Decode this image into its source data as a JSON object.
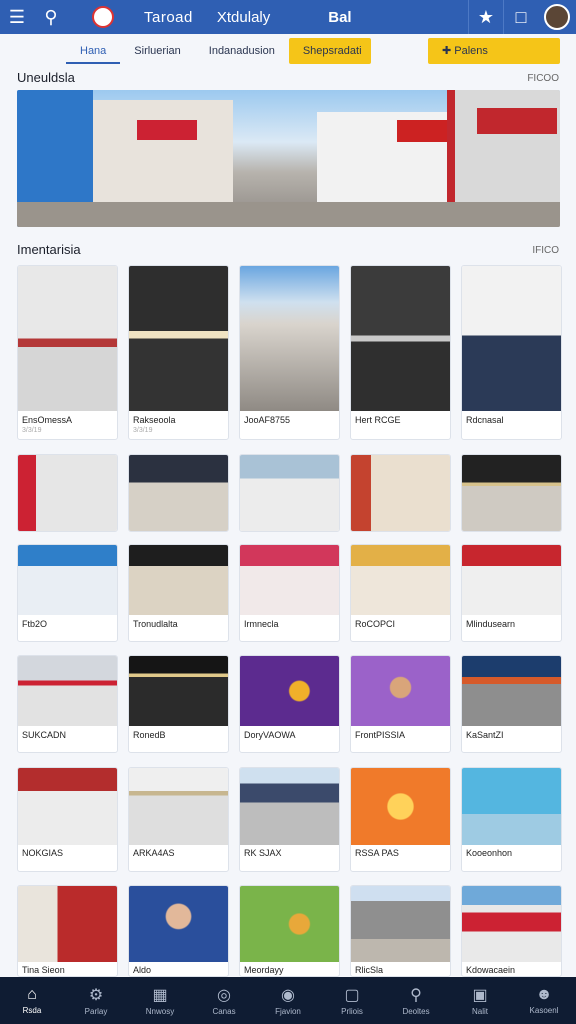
{
  "header": {
    "title": "Taroad",
    "subtitle": "Xtdulaly",
    "brand": "Bal",
    "icons": [
      "menu-icon",
      "search-icon",
      "pet-icon",
      "bell-icon",
      "chat-icon"
    ]
  },
  "tabs": [
    {
      "label": "Hana",
      "active": true
    },
    {
      "label": "Sirluerian"
    },
    {
      "label": "Indanadusion"
    },
    {
      "label": "Shepsradati",
      "style": "yellow"
    },
    {
      "label": "Palens",
      "style": "yellow2"
    }
  ],
  "sections": {
    "featured": {
      "title": "Uneuldsla",
      "more": "FICOO"
    },
    "grid": {
      "title": "Imentarisia",
      "more": "IFICO"
    }
  },
  "rows": [
    {
      "type": "tall",
      "cards": [
        {
          "label": "EnsOmessA",
          "sub": "3/3/19",
          "bg": "#c9ced6"
        },
        {
          "label": "Rakseoola",
          "sub": "3/3/19",
          "bg": "#3a3a3a"
        },
        {
          "label": "JooAF8755",
          "sub": "",
          "bg": "#87a8c8"
        },
        {
          "label": "Hert RCGE",
          "sub": "",
          "bg": "#555b63"
        },
        {
          "label": "Rdcnasal",
          "sub": "",
          "bg": "#8d95a0"
        }
      ]
    },
    {
      "type": "short",
      "cards": [
        {
          "label": "",
          "bg": "#b23b3b"
        },
        {
          "label": "",
          "bg": "#2b3140"
        },
        {
          "label": "",
          "bg": "#a9c2d6"
        },
        {
          "label": "",
          "bg": "#c4432f"
        },
        {
          "label": "",
          "bg": "#222222"
        }
      ]
    },
    {
      "type": "tall2",
      "cards": [
        {
          "label": "Ftb2O",
          "sub": "",
          "bg": "#2f7fc9"
        },
        {
          "label": "Tronudlalta",
          "sub": "",
          "bg": "#1e1e1e"
        },
        {
          "label": "Irmnecla",
          "sub": "",
          "bg": "#d2375b"
        },
        {
          "label": "RoCOPCI",
          "sub": "",
          "bg": "#e3b047"
        },
        {
          "label": "Mlindusearn",
          "sub": "",
          "bg": "#c7262e"
        }
      ]
    },
    {
      "type": "tall3",
      "cards": [
        {
          "label": "SUKCADN",
          "sub": "",
          "bg": "#c9ced6"
        },
        {
          "label": "RonedB",
          "sub": "",
          "bg": "#151515"
        },
        {
          "label": "DoryVAOWA",
          "sub": "",
          "bg": "#5c2b8f"
        },
        {
          "label": "FrontPISSIA",
          "sub": "",
          "bg": "#9b62c9"
        },
        {
          "label": "KaSantZI",
          "sub": "",
          "bg": "#1c3d6d"
        }
      ]
    },
    {
      "type": "tall4",
      "cards": [
        {
          "label": "NOKGIAS",
          "sub": "",
          "bg": "#b32d2d"
        },
        {
          "label": "ARKA4AS",
          "sub": "",
          "bg": "#c7b68f"
        },
        {
          "label": "RK SJAX",
          "sub": "",
          "bg": "#3b4a6b"
        },
        {
          "label": "RSSA PAS",
          "sub": "",
          "bg": "#f07a2a"
        },
        {
          "label": "Kooeonhon",
          "sub": "",
          "bg": "#54b6e0"
        }
      ]
    },
    {
      "type": "last",
      "cards": [
        {
          "label": "Tina Sieon",
          "bg": "#ba2b2b"
        },
        {
          "label": "Aldo",
          "bg": "#2a4f9c"
        },
        {
          "label": "Meordayy",
          "bg": "#7ab44a"
        },
        {
          "label": "RlicSla",
          "bg": "#8f8f8f"
        },
        {
          "label": "Kdowacaein",
          "bg": "#6fa9d9"
        }
      ]
    }
  ],
  "bottom_nav": [
    {
      "label": "Rsda",
      "icon": "home-icon",
      "active": true
    },
    {
      "label": "Parlay",
      "icon": "gear-icon"
    },
    {
      "label": "Nnwosy",
      "icon": "store-icon"
    },
    {
      "label": "Canas",
      "icon": "map-icon"
    },
    {
      "label": "Fjavion",
      "icon": "camera-icon"
    },
    {
      "label": "Prliois",
      "icon": "chat-icon"
    },
    {
      "label": "Deoltes",
      "icon": "pin-icon"
    },
    {
      "label": "Nalit",
      "icon": "square-icon"
    },
    {
      "label": "Kasoenl",
      "icon": "person-icon"
    }
  ]
}
